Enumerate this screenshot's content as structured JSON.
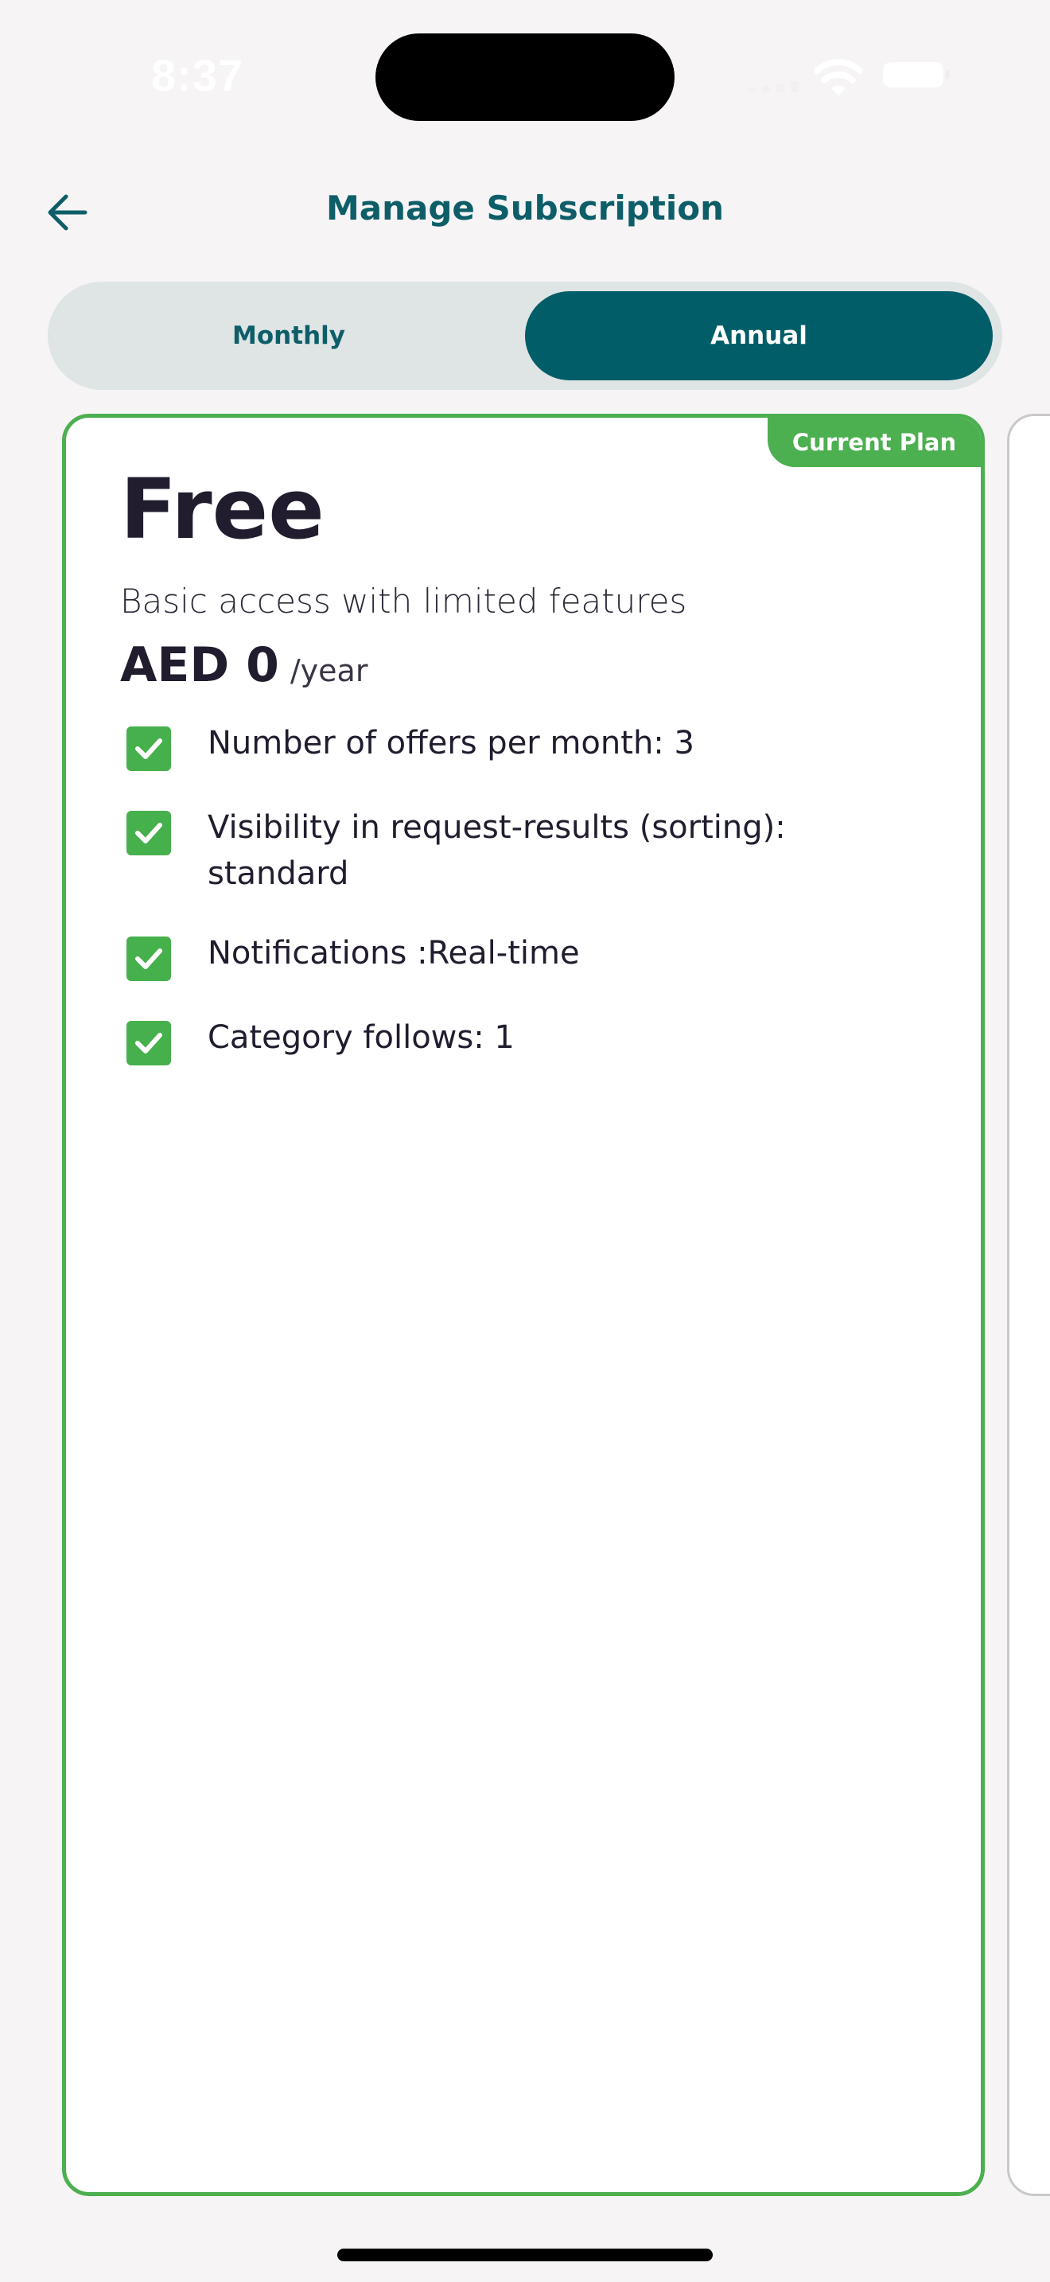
{
  "status_bar": {
    "time": "8:37"
  },
  "header": {
    "title": "Manage Subscription",
    "back_icon": "arrow-left-icon"
  },
  "billing_toggle": {
    "options": [
      {
        "label": "Monthly",
        "selected": false
      },
      {
        "label": "Annual",
        "selected": true
      }
    ]
  },
  "plan": {
    "badge": "Current Plan",
    "name": "Free",
    "description": "Basic access with limited features",
    "price": "AED 0",
    "period": "/year",
    "features": [
      {
        "text": "Number of offers per month: 3"
      },
      {
        "text": "Visibility in request-results (sorting): standard"
      },
      {
        "text": "Notifications :Real-time"
      },
      {
        "text": "Category follows: 1"
      }
    ]
  },
  "colors": {
    "brand": "#015d67",
    "title": "#0d5e68",
    "success": "#4caf50",
    "background": "#f6f4f5",
    "toggle_track": "#dfe4e5"
  }
}
